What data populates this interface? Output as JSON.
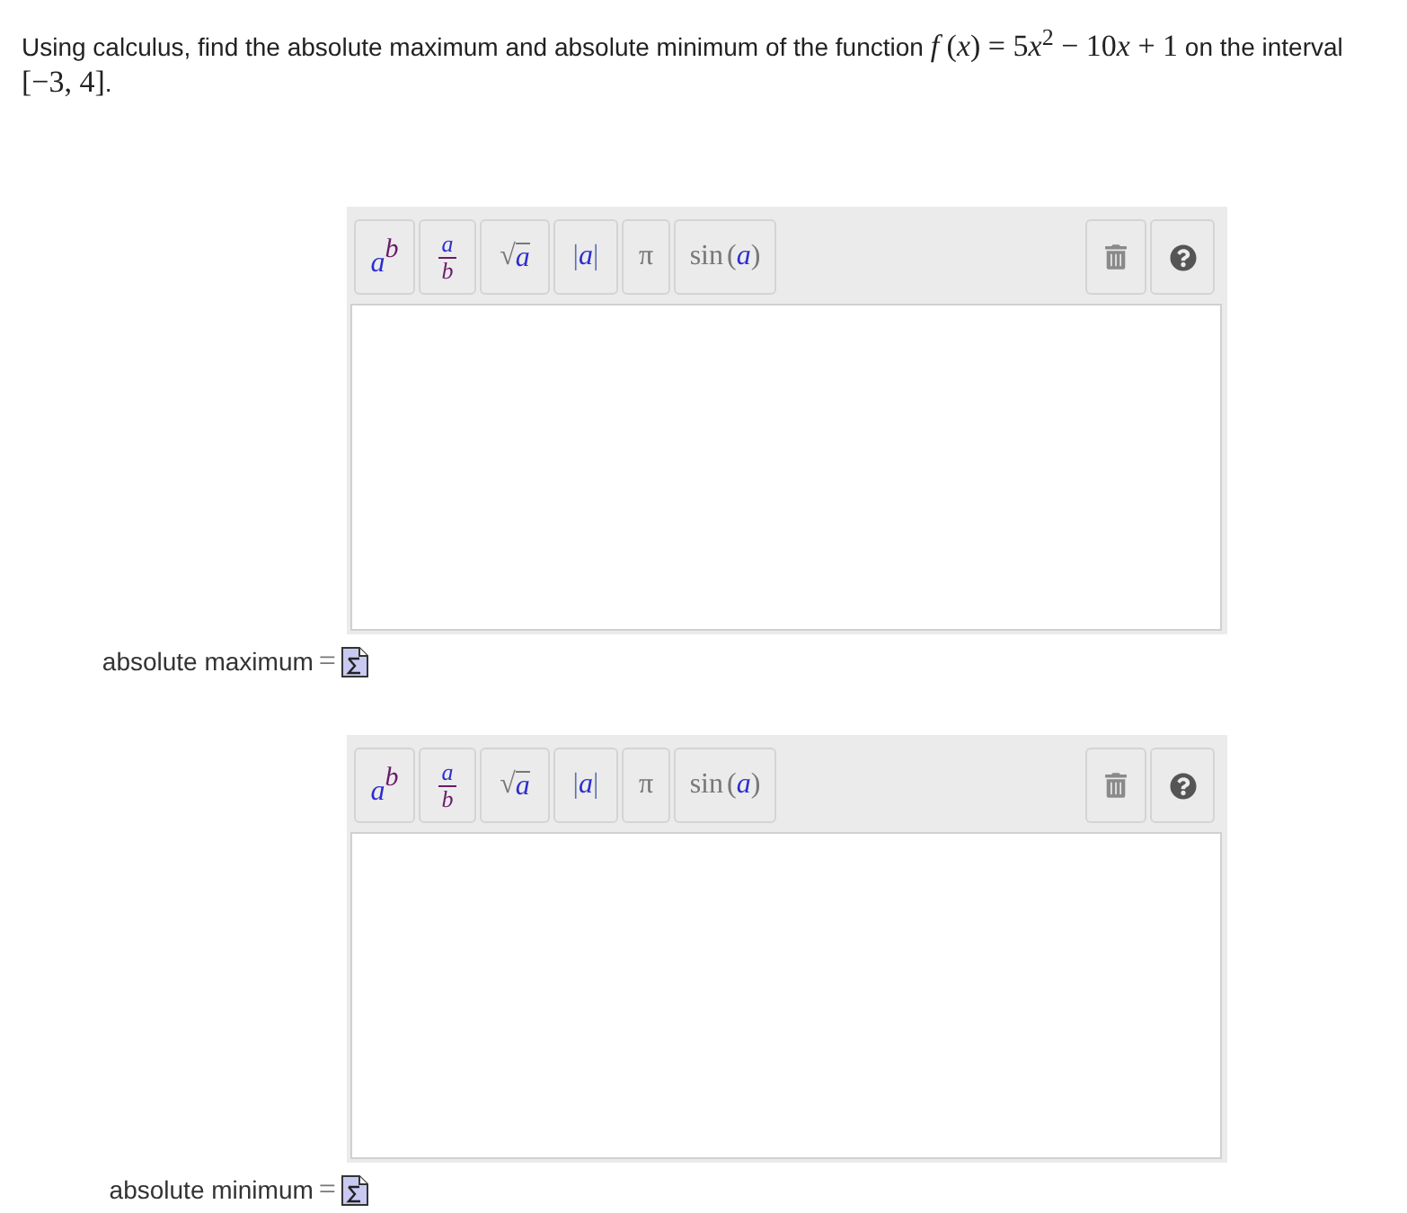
{
  "question": {
    "segments": [
      {
        "kind": "text",
        "text": "Using calculus, find the absolute maximum and absolute minimum of the function "
      },
      {
        "kind": "var",
        "text": "f"
      },
      {
        "kind": "math",
        "text": " ("
      },
      {
        "kind": "var",
        "text": "x"
      },
      {
        "kind": "math",
        "text": ") = 5"
      },
      {
        "kind": "var",
        "text": "x"
      },
      {
        "kind": "sup",
        "text": "2"
      },
      {
        "kind": "math",
        "text": " − 10"
      },
      {
        "kind": "var",
        "text": "x"
      },
      {
        "kind": "math",
        "text": " + 1"
      },
      {
        "kind": "text",
        "text": " on the interval "
      },
      {
        "kind": "math",
        "text": "[−3, 4]"
      },
      {
        "kind": "text",
        "text": "."
      }
    ]
  },
  "answers": [
    {
      "label": "absolute maximum",
      "equals": "=",
      "toolbar": [
        {
          "kind": "power",
          "base": "a",
          "exponent": "b"
        },
        {
          "kind": "fraction",
          "numerator": "a",
          "denominator": "b"
        },
        {
          "kind": "sqrt",
          "symbol": "√",
          "radicand": "a"
        },
        {
          "kind": "abs",
          "left": "|",
          "inner": "a",
          "right": "|"
        },
        {
          "kind": "pi",
          "symbol": "π"
        },
        {
          "kind": "function",
          "name": "sin",
          "open": "(",
          "arg": "a",
          "close": ")"
        }
      ]
    },
    {
      "label": "absolute minimum",
      "equals": "=",
      "toolbar": [
        {
          "kind": "power",
          "base": "a",
          "exponent": "b"
        },
        {
          "kind": "fraction",
          "numerator": "a",
          "denominator": "b"
        },
        {
          "kind": "sqrt",
          "symbol": "√",
          "radicand": "a"
        },
        {
          "kind": "abs",
          "left": "|",
          "inner": "a",
          "right": "|"
        },
        {
          "kind": "pi",
          "symbol": "π"
        },
        {
          "kind": "function",
          "name": "sin",
          "open": "(",
          "arg": "a",
          "close": ")"
        }
      ]
    }
  ]
}
